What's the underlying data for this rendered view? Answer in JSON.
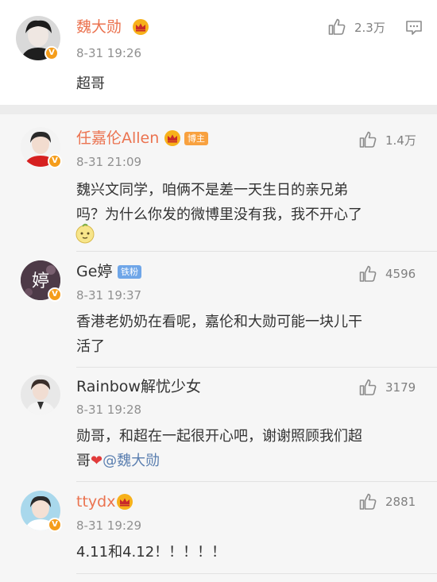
{
  "main_comment": {
    "username": "魏大勋",
    "time": "8-31 19:26",
    "text": "超哥",
    "likes": "2.3万"
  },
  "replies": [
    {
      "username": "任嘉伦Allen",
      "tag": "博主",
      "time": "8-31 21:09",
      "text_line1": "魏兴文同学，咱俩不是差一天生日的亲兄弟",
      "text_line2": "吗？为什么你发的微博里没有我，我不开心了",
      "likes": "1.4万"
    },
    {
      "username": "Ge婷",
      "tag": "铁粉",
      "time": "8-31 19:37",
      "text_line1": "香港老奶奶在看呢，嘉伦和大勋可能一块儿干",
      "text_line2": "活了",
      "avatar_text": "婷",
      "likes": "4596"
    },
    {
      "username": "Rainbow解忧少女",
      "time": "8-31 19:28",
      "text_line1": "勋哥，和超在一起很开心吧，谢谢照顾我们超",
      "text_line2_prefix": "哥",
      "heart": "❤",
      "mention": "@魏大勋",
      "likes": "3179"
    },
    {
      "username": "ttydx",
      "time": "8-31 19:29",
      "text_line1": "4.11和4.12！！！！！",
      "likes": "2881"
    }
  ],
  "colors": {
    "vip_name": "#eb7350",
    "verified_badge": "#f59d1b",
    "mention": "#5b7fb0"
  }
}
